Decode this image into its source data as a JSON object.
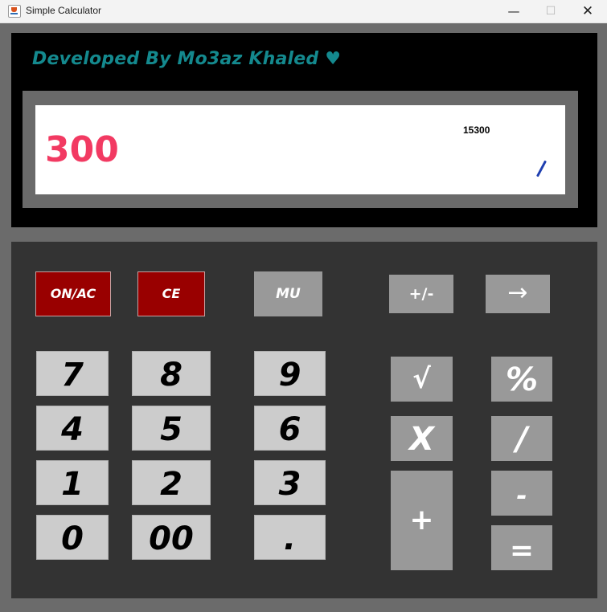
{
  "window": {
    "title": "Simple Calculator",
    "controls": {
      "minimize": "—",
      "maximize": "☐",
      "close": "✕"
    }
  },
  "header": {
    "developer": "Developed By Mo3az Khaled ♥"
  },
  "display": {
    "value": "300",
    "history": "15300"
  },
  "keys": {
    "on_ac": "ON/AC",
    "ce": "CE",
    "mu": "MU",
    "plus_minus": "+/-",
    "backspace": "→",
    "seven": "7",
    "eight": "8",
    "nine": "9",
    "four": "4",
    "five": "5",
    "six": "6",
    "one": "1",
    "two": "2",
    "three": "3",
    "zero": "0",
    "double_zero": "00",
    "dot": ".",
    "sqrt": "√",
    "percent": "%",
    "multiply": "X",
    "divide": "/",
    "plus": "+",
    "minus": "-",
    "equals": "="
  },
  "colors": {
    "developer_text": "#14898e",
    "display_value": "#f23a62",
    "red_keys": "#990000",
    "gray_keys": "#999999",
    "number_keys": "#cccccc",
    "keypad_background": "#333333"
  }
}
